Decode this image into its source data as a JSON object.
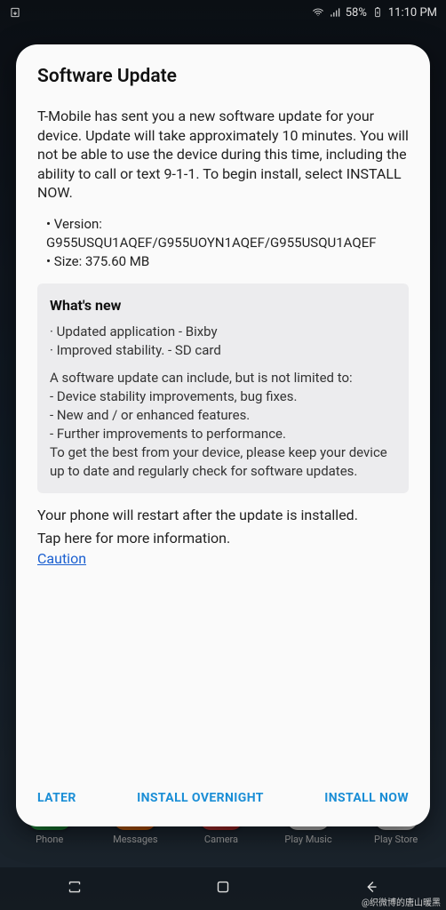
{
  "status": {
    "battery_percent": "58%",
    "clock": "11:10 PM"
  },
  "dialog": {
    "title": "Software Update",
    "intro": "T-Mobile has sent you a new software update for your device. Update will take approximately 10 minutes. You will not be able to use the device during this time, including the ability to call or text 9-1-1. To begin install, select INSTALL NOW.",
    "version_label": "Version: G955USQU1AQEF/G955UOYN1AQEF/G955USQU1AQEF",
    "size_label": "Size: 375.60 MB",
    "whatsnew_title": "What's new",
    "whatsnew_items": [
      "Updated application - Bixby",
      "Improved stability. - SD card"
    ],
    "general_intro": "A software update can include, but is not limited to:",
    "general_items": [
      "Device stability improvements, bug fixes.",
      "New and / or enhanced features.",
      "Further improvements to performance."
    ],
    "general_outro": "To get the best from your device, please keep your device up to date and regularly check for software updates.",
    "restart_note": "Your phone will restart after the update is installed.",
    "tap_more": "Tap here for more information.",
    "caution": "Caution",
    "actions": {
      "later": "LATER",
      "overnight": "INSTALL OVERNIGHT",
      "now": "INSTALL NOW"
    }
  },
  "dock": {
    "phone": "Phone",
    "messages": "Messages",
    "camera": "Camera",
    "music": "Play Music",
    "store": "Play Store"
  },
  "watermark": "@织微博的唐山暖黑"
}
